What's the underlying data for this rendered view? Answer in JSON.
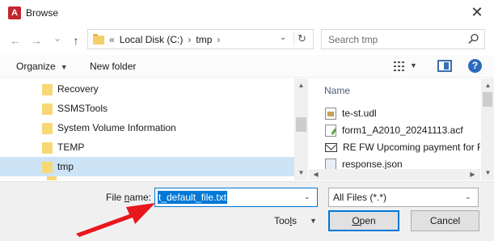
{
  "window": {
    "title": "Browse",
    "app_icon_letter": "A",
    "close_glyph": "✕"
  },
  "nav": {
    "back_glyph": "←",
    "forward_glyph": "→",
    "recent_glyph": "⌄",
    "up_glyph": "↑"
  },
  "address": {
    "overflow": "«",
    "crumbs": [
      "Local Disk (C:)",
      "tmp"
    ],
    "separator": "›",
    "dropdown_glyph": "⌄",
    "refresh_glyph": "↻"
  },
  "search": {
    "placeholder": "Search tmp"
  },
  "toolbar": {
    "organize_label": "Organize",
    "organize_drop": "▼",
    "new_folder_label": "New folder",
    "view_drop": "▼",
    "help_label": "?"
  },
  "tree": {
    "items": [
      {
        "label": "Recovery"
      },
      {
        "label": "SSMSTools"
      },
      {
        "label": "System Volume Information"
      },
      {
        "label": "TEMP"
      },
      {
        "label": "tmp",
        "selected": true
      }
    ],
    "scroll_up": "▲",
    "scroll_down": "▼"
  },
  "files": {
    "column_name": "Name",
    "items": [
      {
        "name": "te-st.udl",
        "icon": "udl-file-icon"
      },
      {
        "name": "form1_A2010_20241113.acf",
        "icon": "acf-file-icon"
      },
      {
        "name": "RE FW Upcoming payment for Fi",
        "icon": "email-file-icon"
      },
      {
        "name": "response.json",
        "icon": "json-file-icon"
      }
    ],
    "scroll_up": "▲",
    "scroll_down": "▼",
    "scroll_left": "◀",
    "scroll_right": "▶"
  },
  "bottom": {
    "file_name_label_pre": "File ",
    "file_name_label_key": "n",
    "file_name_label_post": "ame:",
    "file_name_value": "t_default_file.txt",
    "file_name_drop": "⌄",
    "file_type_value": "All Files (*.*)",
    "file_type_drop": "⌄",
    "tools_pre": "Too",
    "tools_key": "l",
    "tools_post": "s",
    "tools_drop": "▼",
    "open_key": "O",
    "open_rest": "pen",
    "cancel_label": "Cancel"
  },
  "colors": {
    "accent": "#0078d7",
    "selection": "#cde4f7",
    "annotation_arrow": "#e8171c"
  }
}
